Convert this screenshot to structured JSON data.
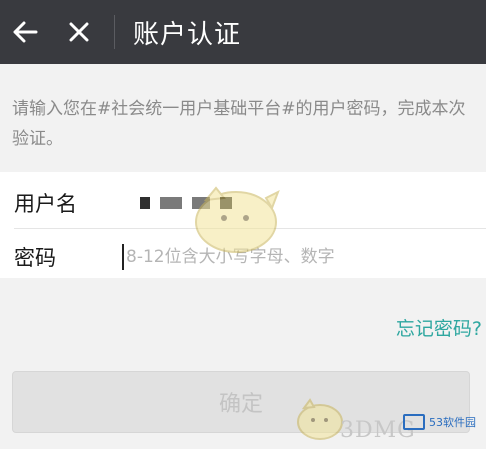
{
  "header": {
    "title": "账户认证",
    "back_icon": "arrow-left-icon",
    "close_icon": "close-icon"
  },
  "tip": {
    "text": "请输入您在#社会统一用户基础平台#的用户密码，完成本次验证。"
  },
  "form": {
    "username_label": "用户名",
    "username_value_masked": true,
    "password_label": "密码",
    "password_placeholder": "8-12位含大小写字母、数字",
    "password_value": ""
  },
  "links": {
    "forgot_password": "忘记密码?"
  },
  "actions": {
    "confirm_label": "确定",
    "confirm_enabled": false
  },
  "watermark": {
    "text": "3DMG",
    "site": "53软件园"
  },
  "colors": {
    "header_bg": "#393a3f",
    "accent_link": "#2ea7a0",
    "page_bg": "#f2f2f2"
  }
}
